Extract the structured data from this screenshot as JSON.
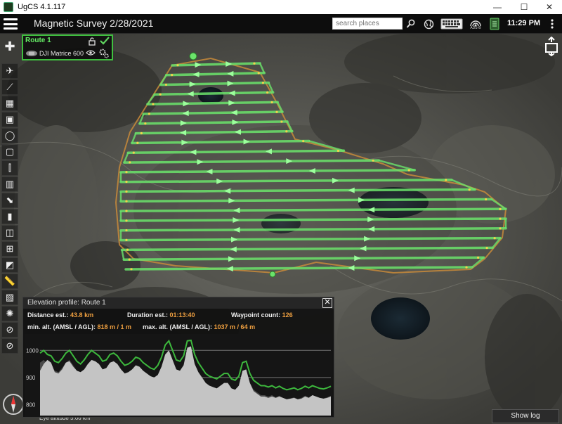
{
  "window": {
    "title": "UgCS 4.1.117",
    "minimize": "—",
    "maximize": "☐",
    "close": "✕"
  },
  "toolbar": {
    "mission_title": "Magnetic Survey 2/28/2021",
    "search_placeholder": "search places",
    "clock": "11:29 PM",
    "icons": [
      "search-icon",
      "globe-icon",
      "keyboard-icon",
      "adsb-icon",
      "device-icon",
      "more-icon"
    ],
    "adsb_label": "ADS-B"
  },
  "route_card": {
    "route_name": "Route 1",
    "drone_name": "DJI Matrice 600",
    "colors": {
      "border": "#3fbf3f",
      "name": "#66ee66"
    }
  },
  "left_tools": [
    "waypoint-add-icon",
    "takeoff-icon",
    "polyline-icon",
    "area-scan-icon",
    "photogrammetry-icon",
    "circle-icon",
    "perimeter-icon",
    "corridor-icon",
    "facade-icon",
    "landing-icon",
    "bars-icon",
    "spiral-icon",
    "network-icon",
    "gradient-icon",
    "ruler-icon",
    "hatch-icon",
    "sun-icon",
    "nofly-zone-icon",
    "forbidden-icon"
  ],
  "elevation": {
    "header": "Elevation profile: Route 1",
    "close_label": "✕",
    "distance_label": "Distance est.:",
    "distance_value": "43.8 km",
    "duration_label": "Duration est.:",
    "duration_value": "01:13:40",
    "waypoint_label": "Waypoint count:",
    "waypoint_value": "126",
    "min_alt_label": "min. alt. (AMSL / AGL):",
    "min_alt_value": "818 m / 1 m",
    "max_alt_label": "max. alt. (AMSL / AGL):",
    "max_alt_value": "1037 m / 64 m",
    "chart_data": {
      "type": "area",
      "ylim": [
        760,
        1050
      ],
      "yticks": [
        "1000",
        "900",
        "800"
      ],
      "terrain": [
        925,
        950,
        965,
        955,
        920,
        915,
        930,
        955,
        960,
        940,
        925,
        920,
        930,
        950,
        965,
        960,
        950,
        930,
        935,
        955,
        960,
        950,
        930,
        915,
        920,
        930,
        945,
        940,
        925,
        915,
        905,
        900,
        910,
        940,
        985,
        1000,
        965,
        930,
        925,
        945,
        1010,
        1015,
        950,
        920,
        900,
        880,
        870,
        865,
        860,
        870,
        880,
        880,
        860,
        855,
        870,
        925,
        930,
        880,
        850,
        840,
        830,
        830,
        825,
        830,
        825,
        830,
        825,
        820,
        822,
        825,
        820,
        822,
        830,
        825,
        835,
        830,
        825,
        822,
        825,
        830
      ],
      "flight": [
        990,
        1000,
        985,
        980,
        960,
        955,
        970,
        990,
        1000,
        980,
        960,
        950,
        965,
        985,
        1000,
        990,
        980,
        960,
        965,
        985,
        990,
        980,
        960,
        945,
        950,
        960,
        975,
        970,
        955,
        945,
        935,
        930,
        945,
        975,
        1020,
        1035,
        1000,
        965,
        960,
        980,
        1035,
        1037,
        985,
        955,
        935,
        915,
        905,
        900,
        895,
        905,
        915,
        915,
        895,
        890,
        905,
        955,
        960,
        915,
        890,
        880,
        870,
        870,
        865,
        870,
        862,
        868,
        860,
        855,
        858,
        862,
        855,
        860,
        868,
        862,
        870,
        865,
        860,
        858,
        862,
        868
      ],
      "colors": {
        "terrain": "#c4c4c4",
        "terrain_shadow": "#4a4a4a",
        "flight": "#3db83d"
      }
    },
    "colors": {
      "value": "#f0a040"
    }
  },
  "show_log": "Show log",
  "eye_altitude": "Eye altitude 5.66 km",
  "map": {
    "route_color": "#6be36b",
    "boundary_color": "#c88a3a"
  }
}
